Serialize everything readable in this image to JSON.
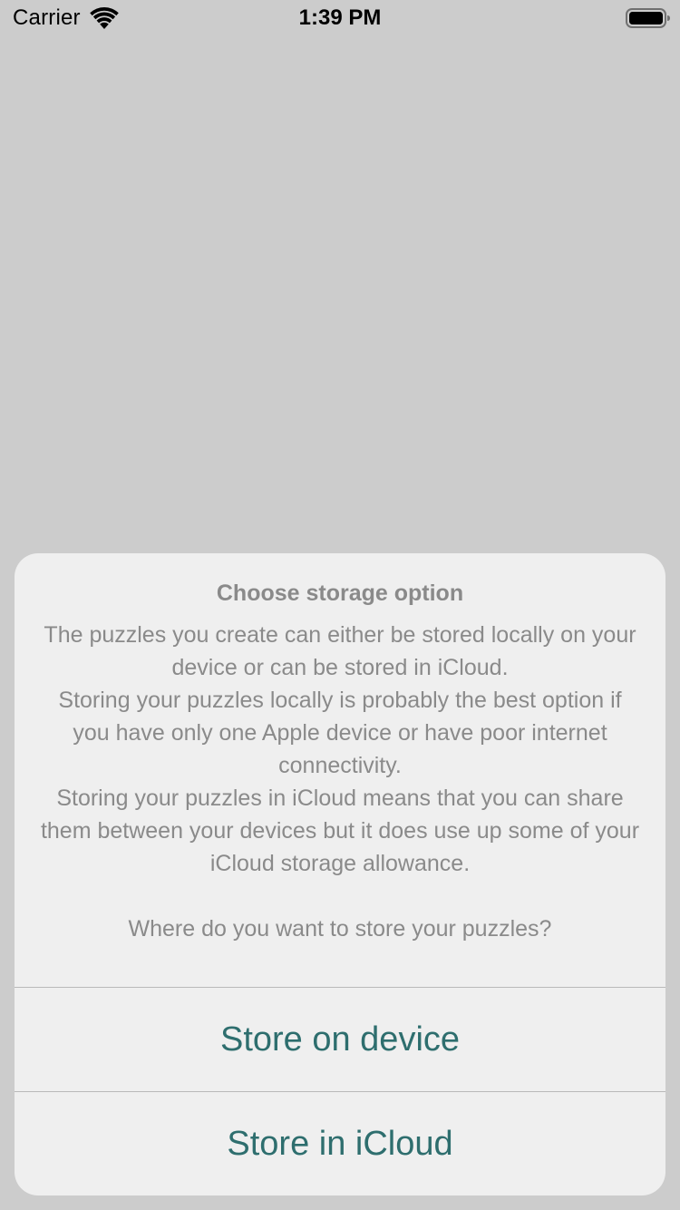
{
  "status_bar": {
    "carrier": "Carrier",
    "time": "1:39 PM",
    "wifi_icon": "wifi-icon",
    "battery_icon": "battery-full-icon"
  },
  "alert": {
    "title": "Choose storage option",
    "message": "The puzzles you create can either be stored locally on your device or can be stored in iCloud.\nStoring your puzzles locally is probably the best option if you have only one Apple device or have poor internet connectivity.\nStoring your puzzles in iCloud means that you can share them between your devices but it does use up some of your iCloud storage allowance.\n\nWhere do you want to store your puzzles?",
    "actions": [
      {
        "label": "Store on device"
      },
      {
        "label": "Store in iCloud"
      }
    ]
  },
  "colors": {
    "background": "#cccccc",
    "sheet": "#efefef",
    "text_secondary": "#8a8a8a",
    "accent": "#2e6e6e"
  }
}
